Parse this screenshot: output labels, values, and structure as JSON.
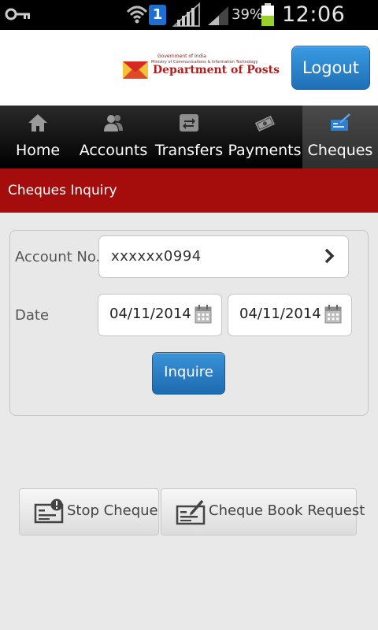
{
  "status_bar": {
    "sim_slot": "1",
    "battery_percent": "39%",
    "clock": "12:06 PM"
  },
  "header": {
    "logo": {
      "gov_line": "Government of India",
      "ministry_line": "Ministry of Communications & Information Technology",
      "dept_name": "Department of Posts"
    },
    "logout_label": "Logout"
  },
  "nav": {
    "tabs": [
      {
        "label": "Home",
        "icon": "home-icon",
        "active": false
      },
      {
        "label": "Accounts",
        "icon": "users-icon",
        "active": false
      },
      {
        "label": "Transfers",
        "icon": "transfer-icon",
        "active": false
      },
      {
        "label": "Payments",
        "icon": "money-icon",
        "active": false
      },
      {
        "label": "Cheques",
        "icon": "cheque-icon",
        "active": true
      }
    ]
  },
  "page_title": "Cheques Inquiry",
  "form": {
    "account_label": "Account No.",
    "account_value": "xxxxxx0994",
    "date_label": "Date",
    "date_from": "04/11/2014",
    "date_to": "04/11/2014",
    "inquire_label": "Inquire"
  },
  "actions": {
    "stop_cheque_label": "Stop Cheque",
    "cheque_book_label": "Cheque Book Request"
  },
  "colors": {
    "title_bar": "#a50d0d",
    "button_blue": "#1f6fb7",
    "nav_bg": "#000000"
  }
}
